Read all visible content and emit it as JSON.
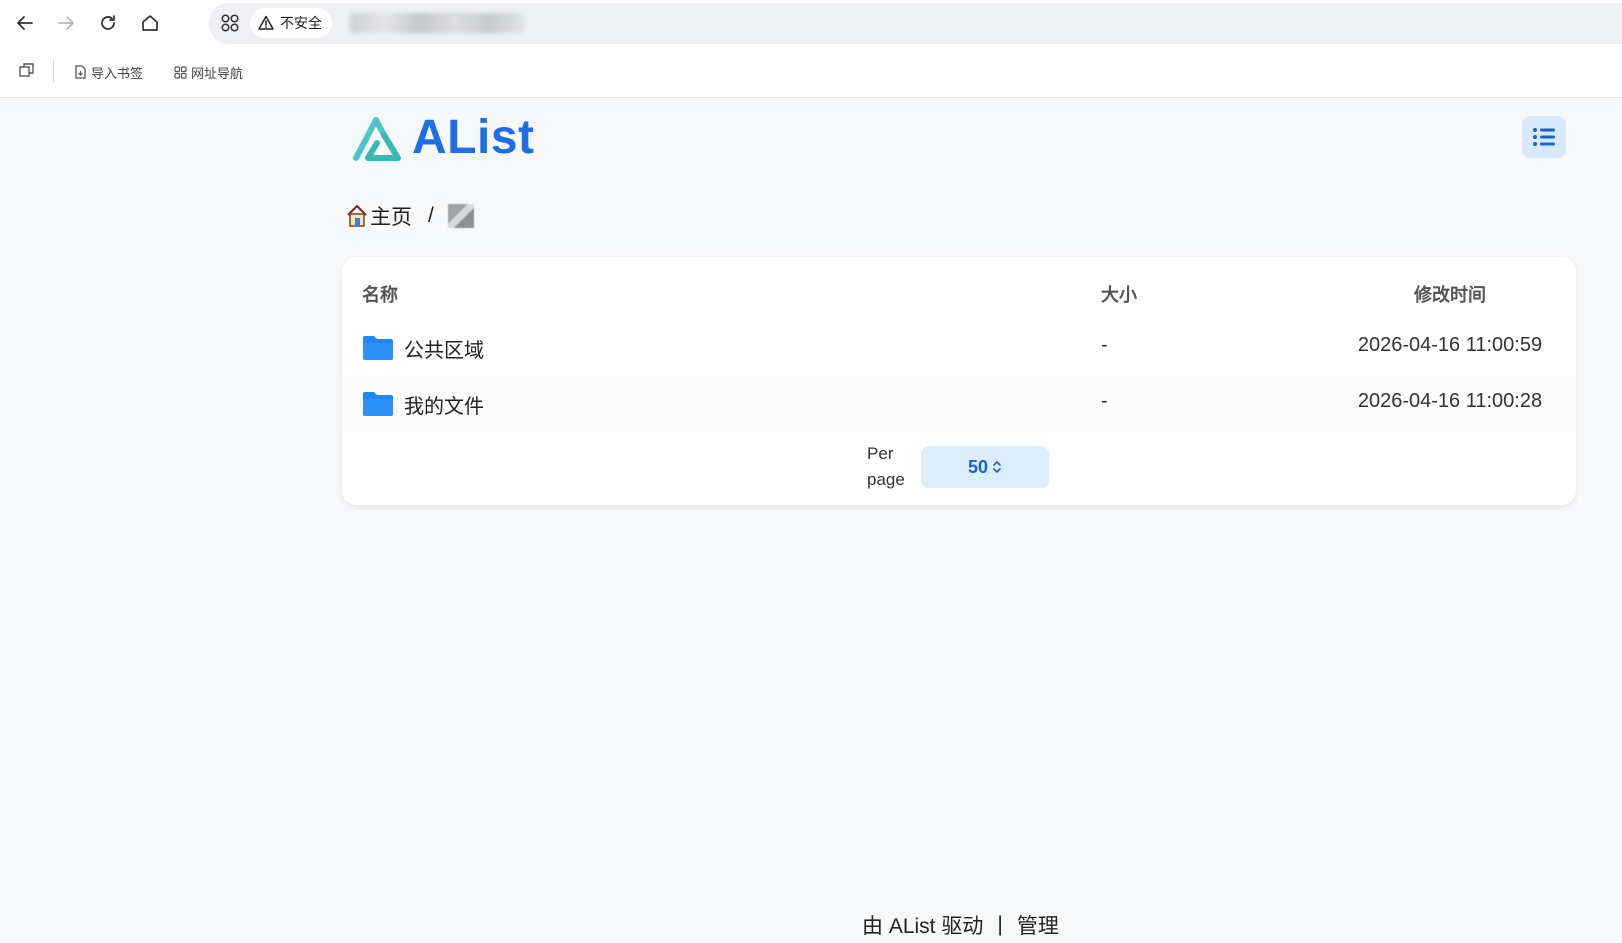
{
  "browser": {
    "security_label": "不安全",
    "bookmarks": [
      {
        "label": "导入书签"
      },
      {
        "label": "网址导航"
      }
    ]
  },
  "site": {
    "logo_text": "AList"
  },
  "breadcrumb": {
    "home_label": "主页",
    "separator": "/"
  },
  "table": {
    "headers": {
      "name": "名称",
      "size": "大小",
      "modified": "修改时间"
    },
    "rows": [
      {
        "name": "公共区域",
        "size": "-",
        "modified": "2026-04-16 11:00:59"
      },
      {
        "name": "我的文件",
        "size": "-",
        "modified": "2026-04-16 11:00:28"
      }
    ]
  },
  "pagination": {
    "per_page_label": "Per page",
    "per_page_value": "50"
  },
  "footer": {
    "powered_by": "由 AList 驱动",
    "separator": "|",
    "admin_label": "管理"
  },
  "colors": {
    "brand": "#1e6fe6",
    "folder": "#1e88f0",
    "accent_bg": "#dcedfc"
  }
}
